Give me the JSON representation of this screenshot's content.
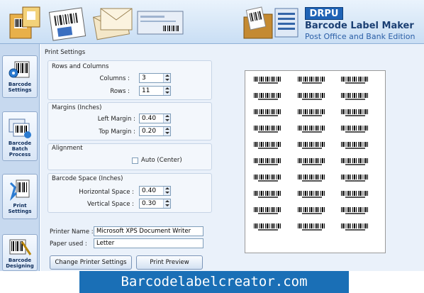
{
  "brand": {
    "tag": "DRPU",
    "title": "Barcode Label Maker",
    "subtitle": "Post Office and Bank Edition",
    "header_icons": [
      "barcode-box-icon",
      "barcode-card-icon",
      "envelopes-icon",
      "bank-cheque-icon",
      "folder-barcode-icon"
    ]
  },
  "sidebar": {
    "items": [
      {
        "label": "Barcode Settings",
        "icon": "barcode-settings-icon"
      },
      {
        "label": "Barcode Batch Process",
        "icon": "batch-process-icon"
      },
      {
        "label": "Print Settings",
        "icon": "print-settings-icon"
      },
      {
        "label": "Barcode Designing",
        "icon": "barcode-designing-icon"
      }
    ]
  },
  "print_settings": {
    "title": "Print Settings",
    "rows_columns": {
      "title": "Rows and Columns",
      "columns_label": "Columns :",
      "columns_value": "3",
      "rows_label": "Rows :",
      "rows_value": "11"
    },
    "margins": {
      "title": "Margins (Inches)",
      "left_label": "Left Margin :",
      "left_value": "0.40",
      "top_label": "Top Margin :",
      "top_value": "0.20"
    },
    "alignment": {
      "title": "Alignment",
      "auto_center_label": "Auto (Center)",
      "auto_center_checked": false
    },
    "barcode_space": {
      "title": "Barcode Space (Inches)",
      "horizontal_label": "Horizontal Space :",
      "horizontal_value": "0.40",
      "vertical_label": "Vertical Space :",
      "vertical_value": "0.30"
    },
    "printer_name_label": "Printer Name :",
    "printer_name_value": "Microsoft XPS Document Writer",
    "paper_used_label": "Paper used :",
    "paper_used_value": "Letter",
    "change_printer_button": "Change Printer Settings",
    "print_preview_button": "Print Preview"
  },
  "preview": {
    "columns": 3,
    "rows": 10
  },
  "footer": {
    "text": "Barcodelabelcreator.com"
  }
}
